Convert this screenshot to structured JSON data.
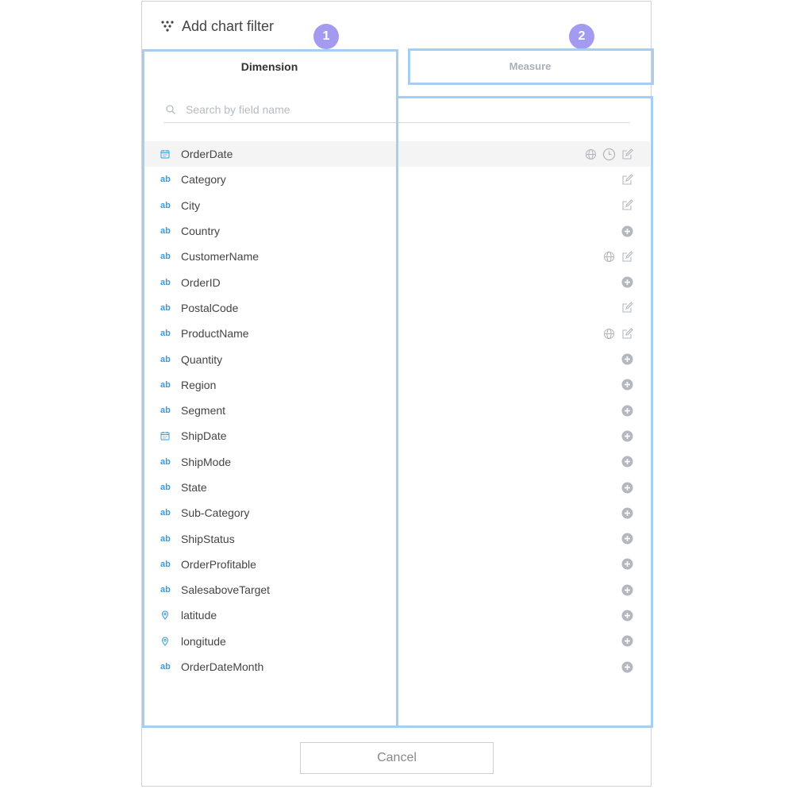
{
  "dialog": {
    "title": "Add chart filter",
    "tabs": [
      {
        "label": "Dimension",
        "active": true
      },
      {
        "label": "Measure",
        "active": false
      }
    ],
    "badges": [
      "1",
      "2"
    ],
    "search": {
      "placeholder": "Search by field name",
      "value": ""
    },
    "fields": [
      {
        "label": "OrderDate",
        "type": "date",
        "actions": [
          "globe-icon",
          "clock-icon",
          "edit-icon"
        ],
        "selected": true
      },
      {
        "label": "Category",
        "type": "text",
        "actions": [
          "edit-icon"
        ]
      },
      {
        "label": "City",
        "type": "text",
        "actions": [
          "edit-icon"
        ]
      },
      {
        "label": "Country",
        "type": "text",
        "actions": [
          "add-icon"
        ]
      },
      {
        "label": "CustomerName",
        "type": "text",
        "actions": [
          "globe-icon",
          "edit-icon"
        ]
      },
      {
        "label": "OrderID",
        "type": "text",
        "actions": [
          "add-icon"
        ]
      },
      {
        "label": "PostalCode",
        "type": "text",
        "actions": [
          "edit-icon"
        ]
      },
      {
        "label": "ProductName",
        "type": "text",
        "actions": [
          "globe-icon",
          "edit-icon"
        ]
      },
      {
        "label": "Quantity",
        "type": "text",
        "actions": [
          "add-icon"
        ]
      },
      {
        "label": "Region",
        "type": "text",
        "actions": [
          "add-icon"
        ]
      },
      {
        "label": "Segment",
        "type": "text",
        "actions": [
          "add-icon"
        ]
      },
      {
        "label": "ShipDate",
        "type": "date",
        "actions": [
          "add-icon"
        ]
      },
      {
        "label": "ShipMode",
        "type": "text",
        "actions": [
          "add-icon"
        ]
      },
      {
        "label": "State",
        "type": "text",
        "actions": [
          "add-icon"
        ]
      },
      {
        "label": "Sub-Category",
        "type": "text",
        "actions": [
          "add-icon"
        ]
      },
      {
        "label": "ShipStatus",
        "type": "text",
        "actions": [
          "add-icon"
        ]
      },
      {
        "label": "OrderProfitable",
        "type": "text",
        "actions": [
          "add-icon"
        ]
      },
      {
        "label": "SalesaboveTarget",
        "type": "text",
        "actions": [
          "add-icon"
        ]
      },
      {
        "label": "latitude",
        "type": "geo",
        "actions": [
          "add-icon"
        ]
      },
      {
        "label": "longitude",
        "type": "geo",
        "actions": [
          "add-icon"
        ]
      },
      {
        "label": "OrderDateMonth",
        "type": "text",
        "actions": [
          "add-icon"
        ]
      }
    ],
    "type_text_label": "ab",
    "cancel_label": "Cancel"
  },
  "colors": {
    "accent": "#3a9bd9",
    "highlight": "#a6cdf2",
    "badge": "#a39bf0",
    "icon_gray": "#b3b8bf"
  }
}
